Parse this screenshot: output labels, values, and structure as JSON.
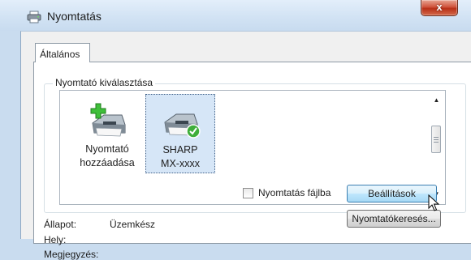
{
  "window": {
    "title": "Nyomtatás",
    "close_label": "x",
    "icon": "printer-icon"
  },
  "tabs": [
    {
      "label": "Általános",
      "selected": true
    }
  ],
  "group": {
    "label": "Nyomtató kiválasztása"
  },
  "printers": [
    {
      "label_lines": [
        "Nyomtató",
        "hozzáadása"
      ],
      "icon": "add-printer-icon",
      "selected": false
    },
    {
      "label_lines": [
        "SHARP",
        "MX-xxxx"
      ],
      "icon": "printer-default-icon",
      "selected": true
    }
  ],
  "status": {
    "status_label": "Állapot:",
    "status_value": "Üzemkész",
    "location_label": "Hely:",
    "location_value": "",
    "comment_label": "Megjegyzés:",
    "comment_value": ""
  },
  "print_to_file": {
    "label": "Nyomtatás fájlba",
    "checked": false
  },
  "buttons": {
    "preferences": "Beállítások",
    "find_printer": "Nyomtatókeresés..."
  }
}
